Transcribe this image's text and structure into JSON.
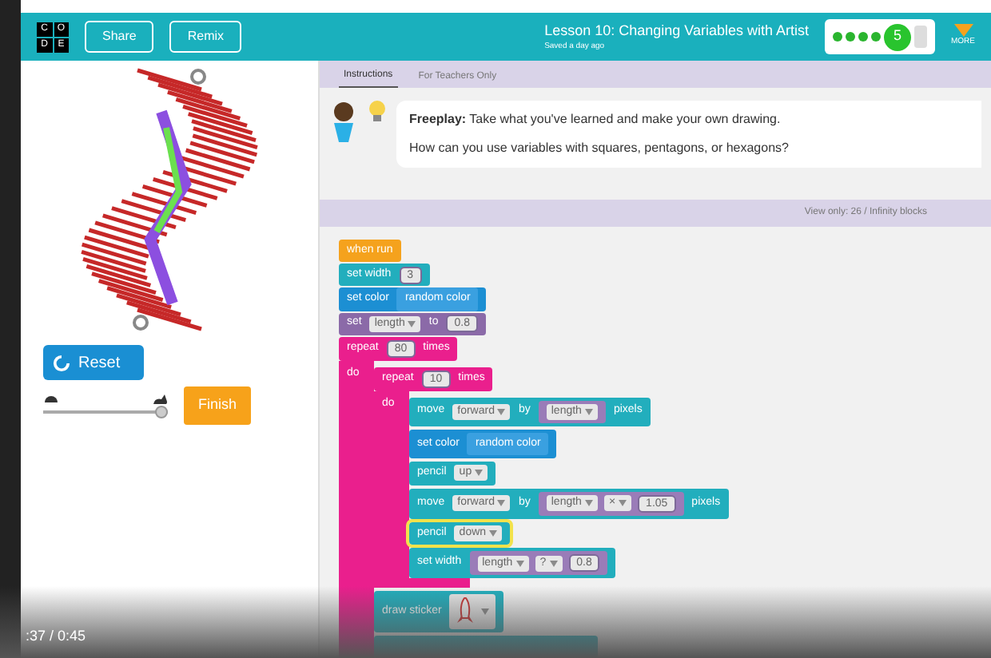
{
  "header": {
    "logo": [
      "C",
      "O",
      "D",
      "E"
    ],
    "buttons": [
      "Share",
      "Remix"
    ],
    "title": "Lesson 10: Changing Variables with Artist",
    "subtitle": "Saved a day ago",
    "progress": [
      {
        "kind": "dot",
        "completed": true
      },
      {
        "kind": "dot",
        "completed": true
      },
      {
        "kind": "dot",
        "completed": true
      },
      {
        "kind": "dot",
        "completed": true
      },
      {
        "kind": "current",
        "label": "5",
        "completed": false
      },
      {
        "kind": "tail",
        "completed": false
      }
    ],
    "more": "MORE"
  },
  "left": {
    "reset": "Reset",
    "speed": {
      "level": 0.95
    },
    "finish": "Finish"
  },
  "tabs": [
    {
      "label": "Instructions",
      "selected": true
    },
    {
      "label": "For Teachers Only",
      "selected": false
    }
  ],
  "instructions": {
    "lead": "Freeplay:",
    "text": "Take what you've learned and make your own drawing.",
    "question": "How can you use variables with squares, pentagons, or hexagons?"
  },
  "workspace_bar": "View only: 26 / Infinity blocks",
  "blocks": [
    {
      "kind": "statement",
      "color": "#f5a21d",
      "selected": false,
      "parts": [
        {
          "kind": "label",
          "text": "when run"
        }
      ]
    },
    {
      "kind": "statement",
      "color": "#22aebd",
      "selected": false,
      "parts": [
        {
          "kind": "label",
          "text": "set width"
        },
        {
          "kind": "number",
          "text": "3"
        }
      ]
    },
    {
      "kind": "statement",
      "color": "#1c8fd3",
      "selected": false,
      "parts": [
        {
          "kind": "label",
          "text": "set color"
        },
        {
          "kind": "reporter",
          "color": "#3aa0e0",
          "parts": [
            {
              "kind": "label",
              "text": "random color"
            }
          ]
        }
      ]
    },
    {
      "kind": "statement",
      "color": "#8b6aa8",
      "selected": false,
      "parts": [
        {
          "kind": "label",
          "text": "set"
        },
        {
          "kind": "dropdown",
          "text": "length"
        },
        {
          "kind": "label",
          "text": "to"
        },
        {
          "kind": "number",
          "text": "0.8"
        }
      ]
    },
    {
      "kind": "loop",
      "color": "#ea1f8d",
      "selected": false,
      "body_label": "do",
      "parts": [
        {
          "kind": "label",
          "text": "repeat"
        },
        {
          "kind": "number",
          "text": "80"
        },
        {
          "kind": "label",
          "text": "times"
        }
      ],
      "children": [
        {
          "kind": "loop",
          "color": "#ea1f8d",
          "selected": false,
          "closed": true,
          "body_label": "do",
          "parts": [
            {
              "kind": "label",
              "text": "repeat"
            },
            {
              "kind": "number",
              "text": "10"
            },
            {
              "kind": "label",
              "text": "times"
            }
          ],
          "children": [
            {
              "kind": "statement",
              "color": "#22aebd",
              "selected": false,
              "parts": [
                {
                  "kind": "label",
                  "text": "move"
                },
                {
                  "kind": "dropdown",
                  "text": "forward"
                },
                {
                  "kind": "label",
                  "text": "by"
                },
                {
                  "kind": "reporter",
                  "color": "#9a7cb8",
                  "parts": [
                    {
                      "kind": "dropdown",
                      "text": "length"
                    }
                  ]
                },
                {
                  "kind": "label",
                  "text": "pixels"
                }
              ]
            },
            {
              "kind": "statement",
              "color": "#1c8fd3",
              "selected": false,
              "parts": [
                {
                  "kind": "label",
                  "text": "set color"
                },
                {
                  "kind": "reporter",
                  "color": "#3aa0e0",
                  "parts": [
                    {
                      "kind": "label",
                      "text": "random color"
                    }
                  ]
                }
              ]
            },
            {
              "kind": "statement",
              "color": "#22aebd",
              "selected": false,
              "parts": [
                {
                  "kind": "label",
                  "text": "pencil"
                },
                {
                  "kind": "dropdown",
                  "text": "up"
                }
              ]
            },
            {
              "kind": "statement",
              "color": "#22aebd",
              "selected": false,
              "parts": [
                {
                  "kind": "label",
                  "text": "move"
                },
                {
                  "kind": "dropdown",
                  "text": "forward"
                },
                {
                  "kind": "label",
                  "text": "by"
                },
                {
                  "kind": "reporter",
                  "color": "#9a7cb8",
                  "parts": [
                    {
                      "kind": "dropdown",
                      "text": "length"
                    },
                    {
                      "kind": "dropdown",
                      "text": "×"
                    },
                    {
                      "kind": "number",
                      "text": "1.05"
                    }
                  ]
                },
                {
                  "kind": "label",
                  "text": "pixels"
                }
              ]
            },
            {
              "kind": "statement",
              "color": "#22aebd",
              "selected": true,
              "parts": [
                {
                  "kind": "label",
                  "text": "pencil"
                },
                {
                  "kind": "dropdown",
                  "text": "down"
                }
              ]
            },
            {
              "kind": "statement",
              "color": "#22aebd",
              "selected": false,
              "parts": [
                {
                  "kind": "label",
                  "text": "set width"
                },
                {
                  "kind": "reporter",
                  "color": "#9a7cb8",
                  "parts": [
                    {
                      "kind": "dropdown",
                      "text": "length"
                    },
                    {
                      "kind": "dropdown",
                      "text": "?"
                    },
                    {
                      "kind": "number",
                      "text": "0.8"
                    }
                  ]
                }
              ]
            }
          ]
        },
        {
          "kind": "statement",
          "color": "#22aebd",
          "selected": false,
          "parts": [
            {
              "kind": "label",
              "text": "draw sticker"
            },
            {
              "kind": "sticker"
            }
          ]
        },
        {
          "kind": "partial",
          "selected": false
        }
      ]
    }
  ],
  "video": {
    "time": ":37 / 0:45"
  }
}
